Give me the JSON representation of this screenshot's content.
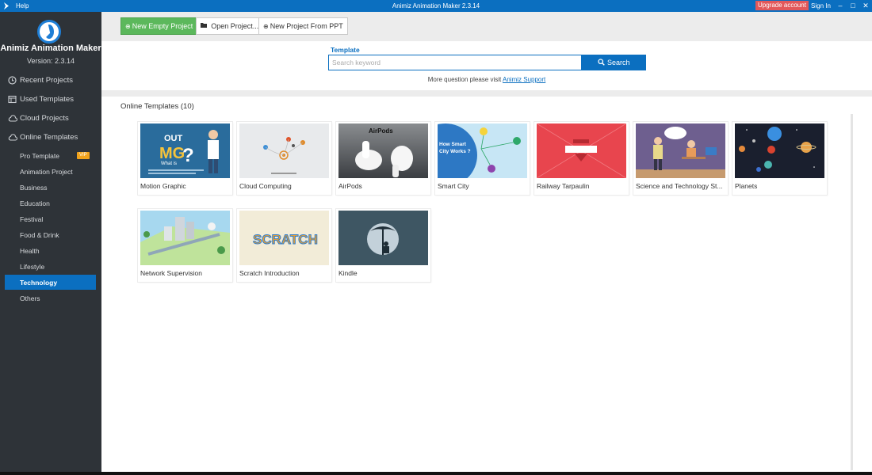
{
  "titlebar": {
    "help": "Help",
    "title": "Animiz Animation Maker 2.3.14",
    "upgrade": "Upgrade account",
    "signin": "Sign In",
    "minimize": "–",
    "maximize": "□",
    "close": "✕"
  },
  "brand": {
    "name": "Animiz Animation Maker",
    "version": "Version: 2.3.14"
  },
  "sidebar": {
    "items": [
      {
        "label": "Recent Projects",
        "icon": "clock-icon"
      },
      {
        "label": "Used Templates",
        "icon": "template-icon"
      },
      {
        "label": "Cloud Projects",
        "icon": "cloud-icon"
      },
      {
        "label": "Online Templates",
        "icon": "cloud-online-icon"
      }
    ],
    "subitems": [
      {
        "label": "Pro Template",
        "badge": "VIP"
      },
      {
        "label": "Animation Project"
      },
      {
        "label": "Business"
      },
      {
        "label": "Education"
      },
      {
        "label": "Festival"
      },
      {
        "label": "Food & Drink"
      },
      {
        "label": "Health"
      },
      {
        "label": "Lifestyle"
      },
      {
        "label": "Technology",
        "active": true
      },
      {
        "label": "Others"
      }
    ]
  },
  "toolbar": {
    "new_empty": "New Empty Project",
    "open": "Open Project...",
    "from_ppt": "New Project From PPT"
  },
  "search": {
    "label": "Template",
    "placeholder": "Search keyword",
    "button": "Search",
    "support_text": "More question please visit",
    "support_link": "Animiz Support"
  },
  "templates": {
    "heading": "Online Templates (10)",
    "items": [
      {
        "name": "Motion Graphic"
      },
      {
        "name": "Cloud Computing"
      },
      {
        "name": "AirPods",
        "thumb_text": "AirPods"
      },
      {
        "name": "Smart City",
        "thumb_text": "How Smart City Works ?"
      },
      {
        "name": "Railway Tarpaulin"
      },
      {
        "name": "Science and Technology St..."
      },
      {
        "name": "Planets"
      },
      {
        "name": "Network Supervision"
      },
      {
        "name": "Scratch Introduction",
        "thumb_text": "SCRATCH"
      },
      {
        "name": "Kindle"
      }
    ]
  },
  "colors": {
    "accent": "#0b6fc0",
    "sidebar_bg": "#2e3338",
    "green": "#5cb85c",
    "upgrade": "#e2585a"
  }
}
